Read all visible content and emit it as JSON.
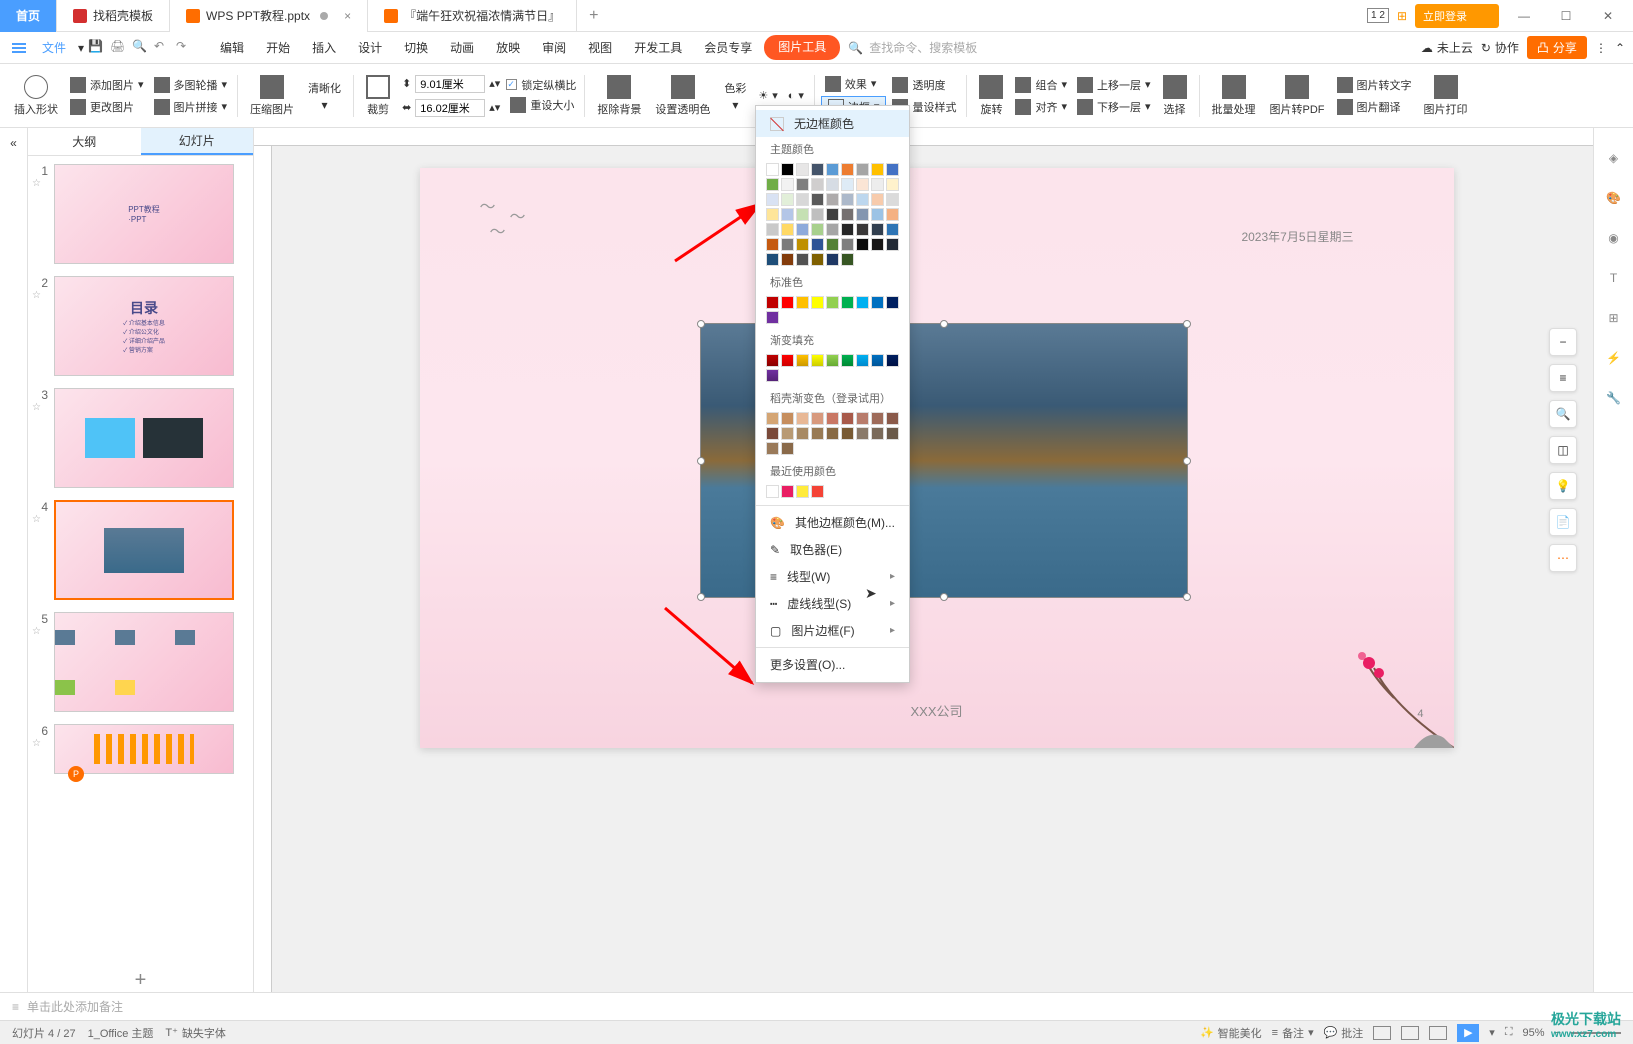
{
  "tabs": {
    "home": "首页",
    "template": "找稻壳模板",
    "active": "WPS PPT教程.pptx",
    "other": "『端午狂欢祝福浓情满节日』"
  },
  "title_right": {
    "login": "立即登录"
  },
  "menu": {
    "file": "文件",
    "items": [
      "编辑",
      "开始",
      "插入",
      "设计",
      "切换",
      "动画",
      "放映",
      "审阅",
      "视图",
      "开发工具",
      "会员专享"
    ],
    "pic_tool": "图片工具",
    "search_ph": "查找命令、搜索模板",
    "cloud": "未上云",
    "coop": "协作",
    "share": "分享"
  },
  "toolbar": {
    "insert_shape": "插入形状",
    "add_pic": "添加图片",
    "multi_carousel": "多图轮播",
    "change_pic": "更改图片",
    "pic_merge": "图片拼接",
    "compress": "压缩图片",
    "sharpen": "清晰化",
    "crop": "裁剪",
    "width": "9.01厘米",
    "height": "16.02厘米",
    "lock_ratio": "锁定纵横比",
    "reset_size": "重设大小",
    "remove_bg": "抠除背景",
    "set_trans": "设置透明色",
    "color": "色彩",
    "effect": "效果",
    "trans": "透明度",
    "border": "边框",
    "ruler_style": "量设样式",
    "rotate": "旋转",
    "group": "组合",
    "align": "对齐",
    "move_up": "上移一层",
    "move_down": "下移一层",
    "select": "选择",
    "batch": "批量处理",
    "to_pdf": "图片转PDF",
    "pic_to_text": "图片转文字",
    "pic_translate": "图片翻译",
    "pic_print": "图片打印"
  },
  "slide_panel": {
    "outline": "大纲",
    "slides": "幻灯片",
    "slide2_title": "目录",
    "slide2_items": [
      "介绍基本信息",
      "介绍公文化",
      "详细介绍产品",
      "营销方案"
    ]
  },
  "canvas": {
    "date": "2023年7月5日星期三",
    "company": "XXX公司",
    "slide_page": "4"
  },
  "dropdown": {
    "no_border": "无边框颜色",
    "theme_colors": "主题颜色",
    "standard_colors": "标准色",
    "gradient_fill": "渐变填充",
    "douke_colors": "稻壳渐变色（登录试用）",
    "recent_colors": "最近使用颜色",
    "more_border": "其他边框颜色(M)...",
    "picker": "取色器(E)",
    "line_type": "线型(W)",
    "dash_type": "虚线线型(S)",
    "pic_border": "图片边框(F)",
    "more_settings": "更多设置(O)..."
  },
  "notes": "单击此处添加备注",
  "status": {
    "slide_info": "幻灯片 4 / 27",
    "theme": "1_Office 主题",
    "missing_font": "缺失字体",
    "smart_beauty": "智能美化",
    "notes_btn": "备注",
    "review": "批注",
    "zoom": "95%"
  },
  "watermark": {
    "main": "极光下载站",
    "sub": "www.xz7.com"
  }
}
